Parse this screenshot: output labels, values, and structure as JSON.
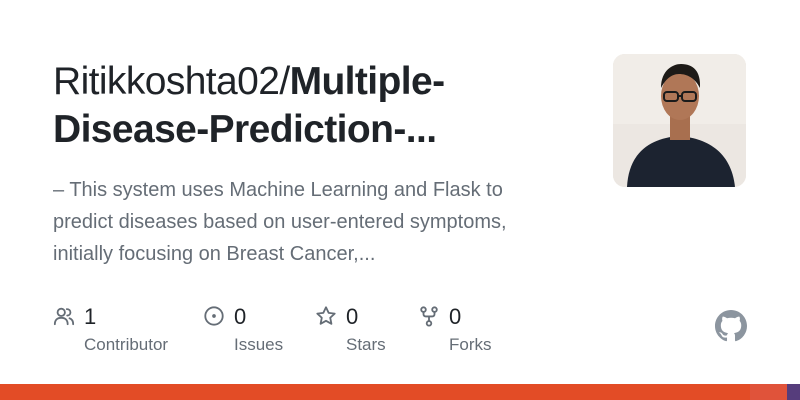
{
  "repo": {
    "owner": "Ritikkoshta02/",
    "name_line1": "Multiple-",
    "name_line2": "Disease-Prediction-..."
  },
  "description": {
    "line1": "– This system uses Machine Learning and Flask to",
    "line2": "predict diseases based on user-entered symptoms,",
    "line3": "initially focusing on Breast Cancer,..."
  },
  "stats": {
    "contributors": {
      "count": "1",
      "label": "Contributor",
      "icon": "people-icon"
    },
    "issues": {
      "count": "0",
      "label": "Issues",
      "icon": "issue-opened-icon"
    },
    "stars": {
      "count": "0",
      "label": "Stars",
      "icon": "star-icon"
    },
    "forks": {
      "count": "0",
      "label": "Forks",
      "icon": "repo-forked-icon"
    }
  },
  "colors": {
    "language_bar": [
      "#e34c26",
      "#e0533a",
      "#563d7c"
    ],
    "text_primary": "#1f2328",
    "text_muted": "#656d76"
  }
}
